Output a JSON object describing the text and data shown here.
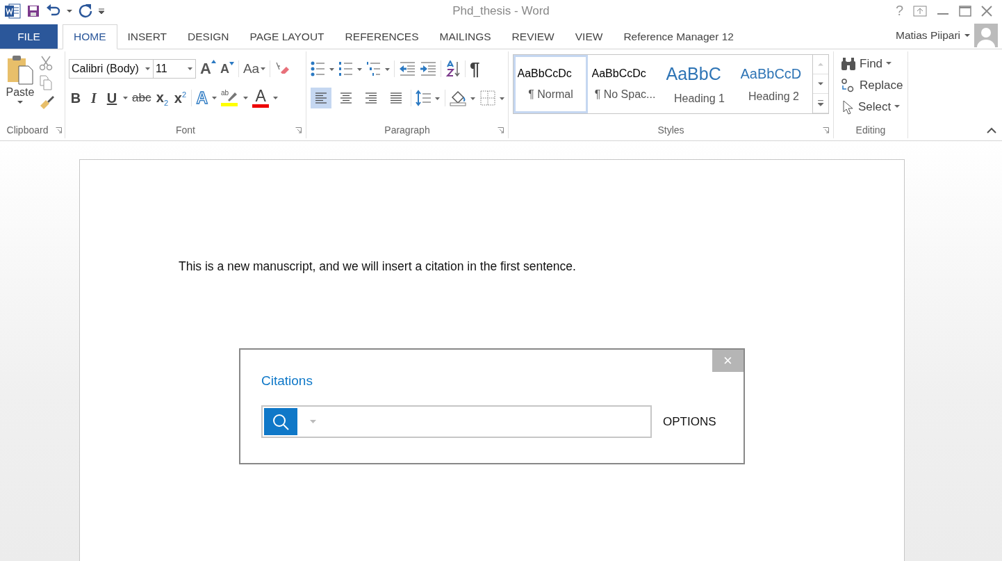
{
  "window": {
    "title": "Phd_thesis - Word",
    "help": "?"
  },
  "tabs": [
    {
      "label": "FILE",
      "kind": "file",
      "selected": false
    },
    {
      "label": "HOME",
      "kind": "tab",
      "selected": true
    },
    {
      "label": "INSERT",
      "kind": "tab",
      "selected": false
    },
    {
      "label": "DESIGN",
      "kind": "tab",
      "selected": false
    },
    {
      "label": "PAGE LAYOUT",
      "kind": "tab",
      "selected": false
    },
    {
      "label": "REFERENCES",
      "kind": "tab",
      "selected": false
    },
    {
      "label": "MAILINGS",
      "kind": "tab",
      "selected": false
    },
    {
      "label": "REVIEW",
      "kind": "tab",
      "selected": false
    },
    {
      "label": "VIEW",
      "kind": "tab",
      "selected": false
    },
    {
      "label": "Reference Manager 12",
      "kind": "tab",
      "selected": false
    }
  ],
  "account": {
    "name": "Matias Piipari"
  },
  "ribbon": {
    "clipboard": {
      "label": "Clipboard",
      "paste": "Paste"
    },
    "font": {
      "label": "Font",
      "family": "Calibri (Body)",
      "size": "11",
      "grow": "A",
      "shrink": "A",
      "case": "Aa",
      "formats": [
        {
          "kind": "bold",
          "text": "B"
        },
        {
          "kind": "italic",
          "text": "I"
        },
        {
          "kind": "underline",
          "text": "U"
        },
        {
          "kind": "strike",
          "text": "abc"
        },
        {
          "kind": "sub",
          "text": "x$_{2}$"
        },
        {
          "kind": "sup",
          "text": "x$^{2}$"
        }
      ],
      "effects": "A",
      "highlight": "ab",
      "font_color": "A"
    },
    "paragraph": {
      "label": "Paragraph",
      "marks": "¶",
      "alignments": [
        {
          "kind": "left",
          "selected": true
        },
        {
          "kind": "center",
          "selected": false
        },
        {
          "kind": "right",
          "selected": false
        },
        {
          "kind": "justify",
          "selected": false
        }
      ]
    },
    "styles": {
      "label": "Styles",
      "items": [
        {
          "preview": "AaBbCcDc",
          "name": "¶ Normal",
          "kind": "normal",
          "selected": true
        },
        {
          "preview": "AaBbCcDc",
          "name": "¶ No Spac...",
          "kind": "normal",
          "selected": false
        },
        {
          "preview": "AaBbC",
          "name": "Heading 1",
          "kind": "heading1",
          "selected": false
        },
        {
          "preview": "AaBbCcD",
          "name": "Heading 2",
          "kind": "heading2",
          "selected": false
        }
      ]
    },
    "editing": {
      "label": "Editing",
      "items": [
        {
          "kind": "find",
          "label": "Find"
        },
        {
          "kind": "replace",
          "label": "Replace"
        },
        {
          "kind": "select",
          "label": "Select"
        }
      ]
    }
  },
  "document": {
    "paragraphs": [
      "This is a new manuscript, and we will insert a citation in the first sentence."
    ]
  },
  "citations_panel": {
    "title": "Citations",
    "close": "×",
    "options": "OPTIONS"
  }
}
